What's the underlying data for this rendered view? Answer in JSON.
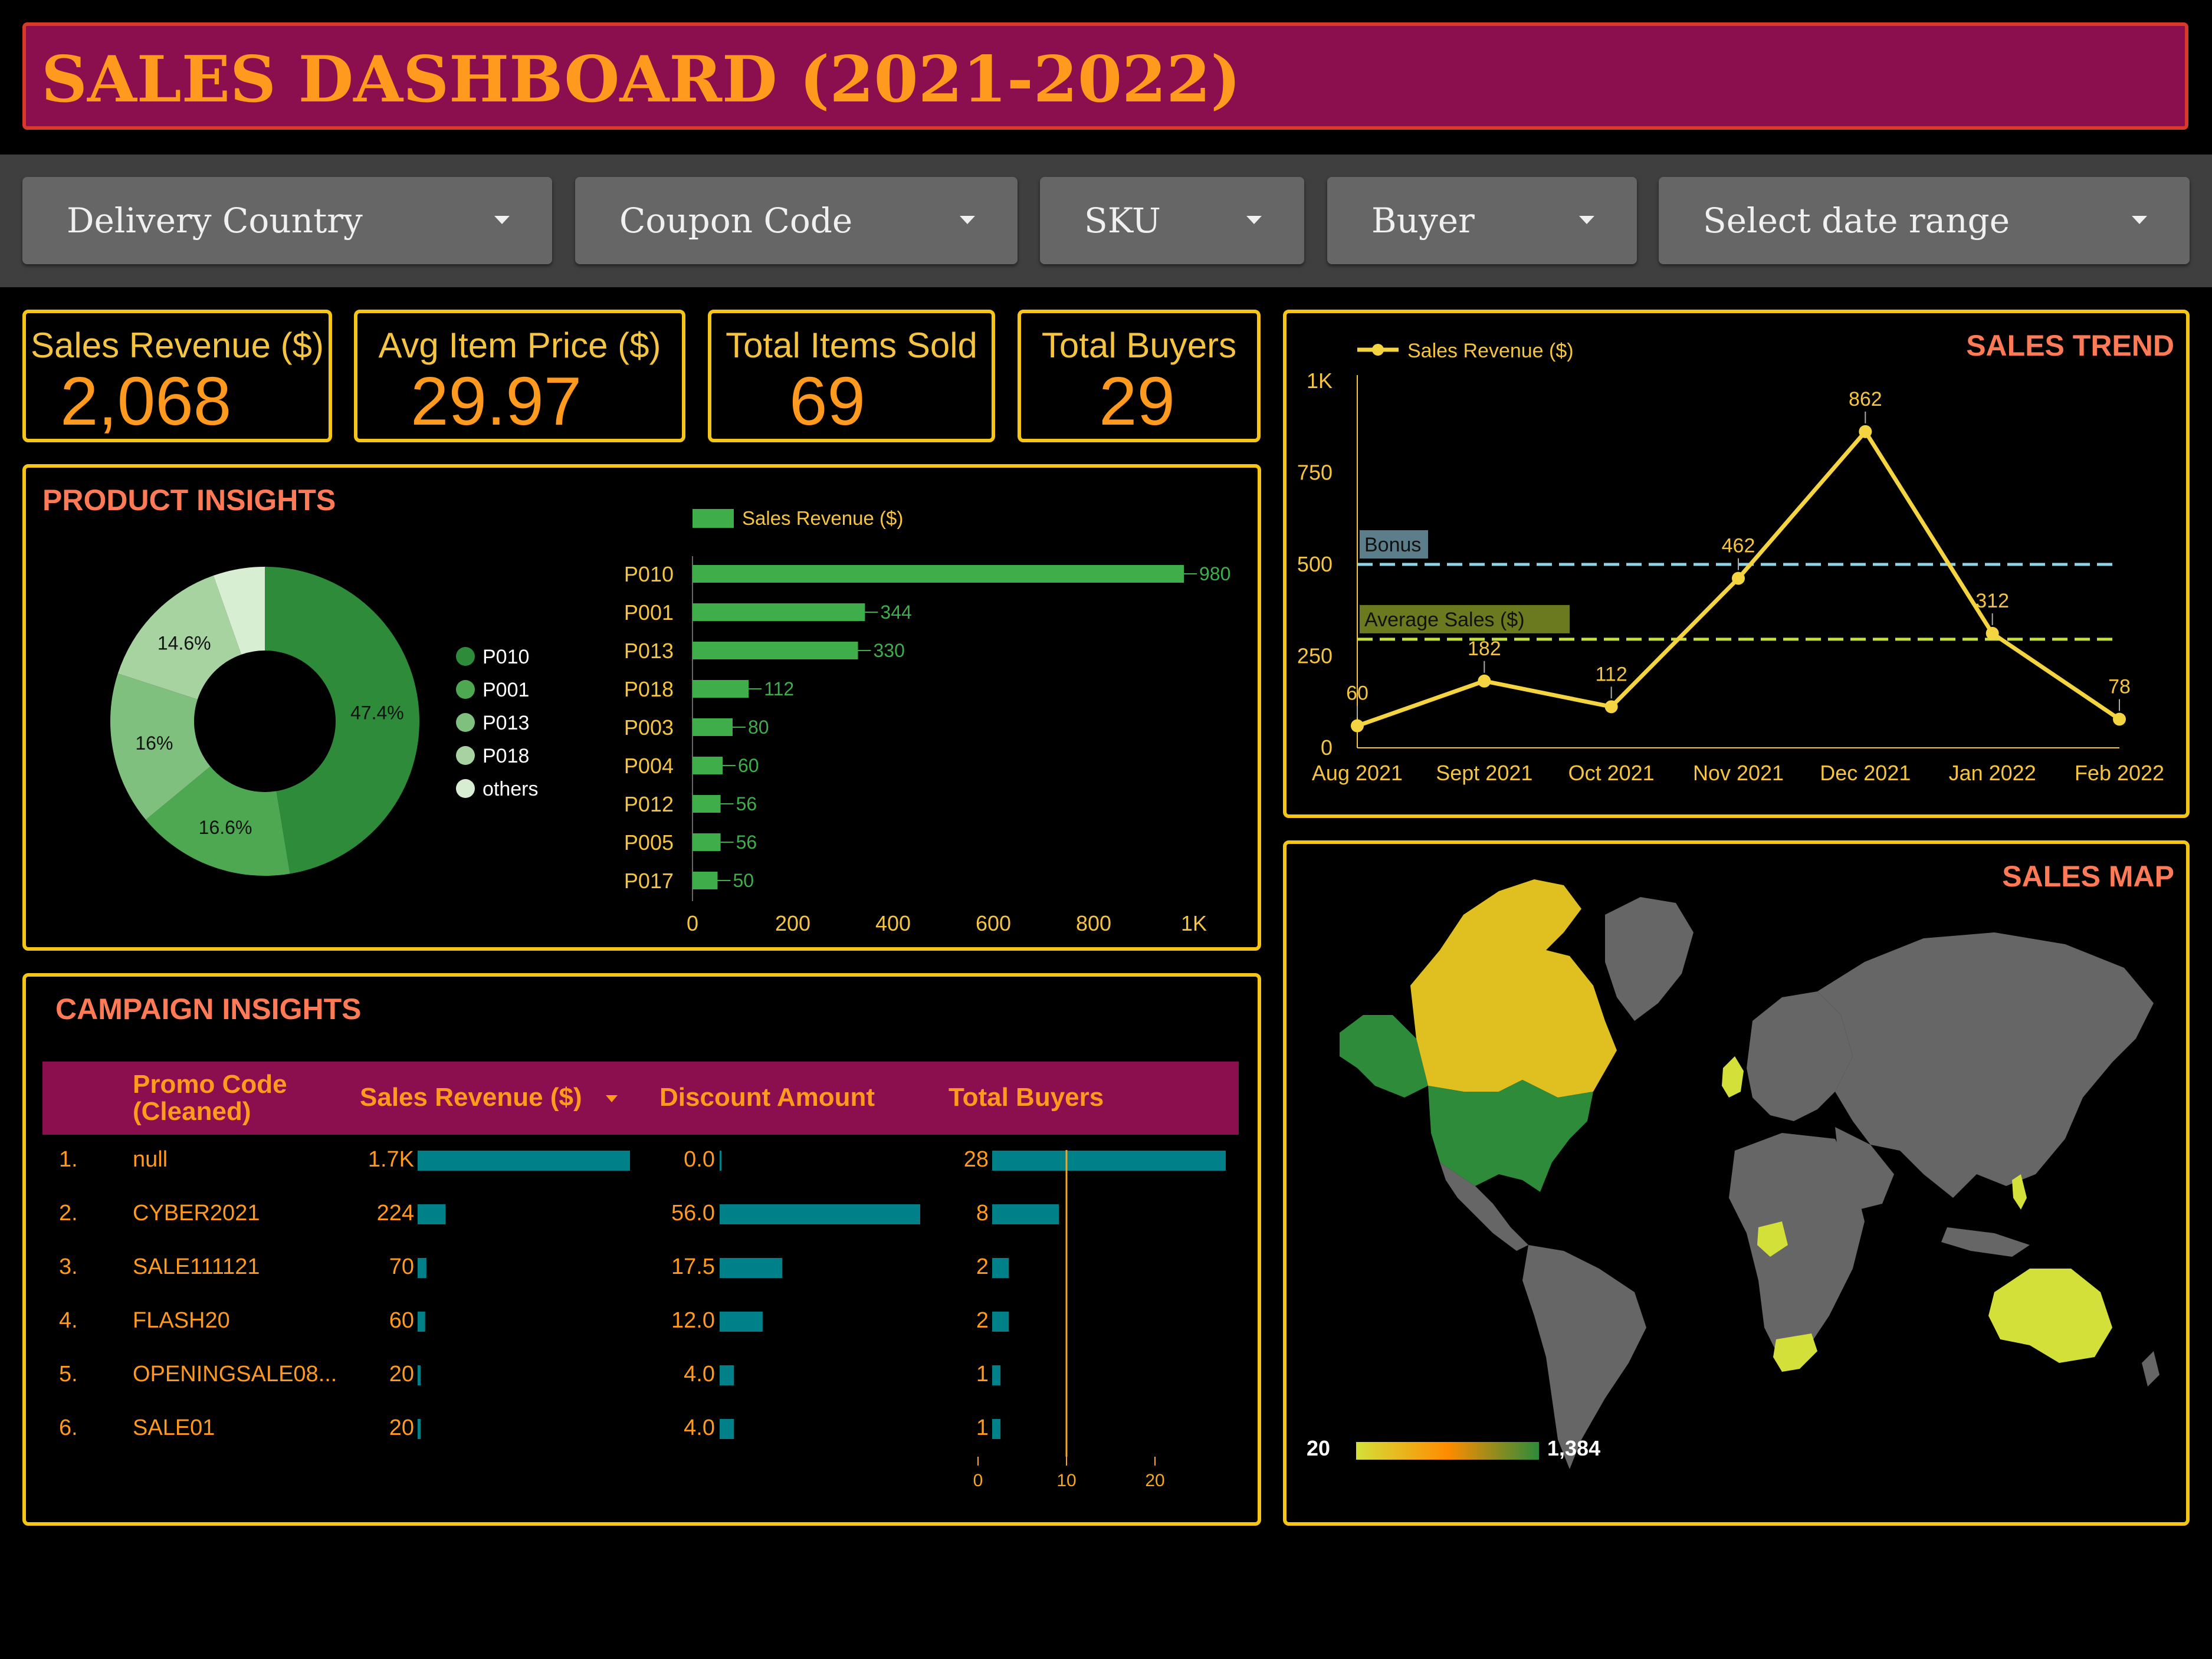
{
  "header": {
    "title": "SALES DASHBOARD (2021-2022)"
  },
  "filters": [
    {
      "label": "Delivery Country"
    },
    {
      "label": "Coupon Code"
    },
    {
      "label": "SKU"
    },
    {
      "label": "Buyer"
    },
    {
      "label": "Select date range"
    }
  ],
  "kpis": [
    {
      "label": "Sales Revenue ($)",
      "value": "2,068"
    },
    {
      "label": "Avg Item Price ($)",
      "value": "29.97"
    },
    {
      "label": "Total Items Sold",
      "value": "69"
    },
    {
      "label": "Total Buyers",
      "value": "29"
    }
  ],
  "product_insights": {
    "title": "PRODUCT INSIGHTS"
  },
  "campaign_insights": {
    "title": "CAMPAIGN INSIGHTS",
    "columns": [
      "Promo Code (Cleaned)",
      "Sales Revenue ($)",
      "Discount Amount",
      "Total Buyers"
    ],
    "col1_line1": "Promo Code",
    "col1_line2": "(Cleaned)",
    "rows": [
      {
        "rank": "1.",
        "code": "null",
        "revenue_label": "1.7K",
        "revenue": 1700,
        "discount_label": "0.0",
        "discount": 0,
        "buyers_label": "28",
        "buyers": 28
      },
      {
        "rank": "2.",
        "code": "CYBER2021",
        "revenue_label": "224",
        "revenue": 224,
        "discount_label": "56.0",
        "discount": 56,
        "buyers_label": "8",
        "buyers": 8
      },
      {
        "rank": "3.",
        "code": "SALE111121",
        "revenue_label": "70",
        "revenue": 70,
        "discount_label": "17.5",
        "discount": 17.5,
        "buyers_label": "2",
        "buyers": 2
      },
      {
        "rank": "4.",
        "code": "FLASH20",
        "revenue_label": "60",
        "revenue": 60,
        "discount_label": "12.0",
        "discount": 12,
        "buyers_label": "2",
        "buyers": 2
      },
      {
        "rank": "5.",
        "code": "OPENINGSALE08...",
        "revenue_label": "20",
        "revenue": 20,
        "discount_label": "4.0",
        "discount": 4,
        "buyers_label": "1",
        "buyers": 1
      },
      {
        "rank": "6.",
        "code": "SALE01",
        "revenue_label": "20",
        "revenue": 20,
        "discount_label": "4.0",
        "discount": 4,
        "buyers_label": "1",
        "buyers": 1
      }
    ],
    "buyers_axis_ticks": [
      "0",
      "10",
      "20"
    ],
    "buyers_reference": 10,
    "bar_color": "#00818a"
  },
  "sales_trend": {
    "title": "SALES TREND"
  },
  "sales_map": {
    "title": "SALES MAP",
    "legend_min": "20",
    "legend_max": "1,384",
    "colors": {
      "land": "#666666",
      "low": "#d4e03a",
      "mid": "#e0c020",
      "high": "#2e8b3a"
    }
  },
  "chart_data": [
    {
      "type": "pie",
      "subtype": "donut",
      "categories": [
        "P010",
        "P001",
        "P013",
        "P018",
        "others"
      ],
      "values": [
        47.4,
        16.6,
        16.0,
        14.6,
        5.4
      ],
      "labels": [
        "47.4%",
        "16.6%",
        "16%",
        "14.6%",
        ""
      ],
      "colors": [
        "#2e8b3a",
        "#4ea852",
        "#7fc07f",
        "#a6d3a0",
        "#d8eed2"
      ],
      "legend": "right"
    },
    {
      "type": "bar",
      "orientation": "horizontal",
      "categories": [
        "P010",
        "P001",
        "P013",
        "P018",
        "P003",
        "P004",
        "P012",
        "P005",
        "P017"
      ],
      "series": [
        {
          "name": "Sales Revenue ($)",
          "values": [
            980,
            344,
            330,
            112,
            80,
            60,
            56,
            56,
            50
          ]
        }
      ],
      "xlim": [
        0,
        1000
      ],
      "xticks": [
        "0",
        "200",
        "400",
        "600",
        "800",
        "1K"
      ],
      "color": "#3fae4a",
      "legend": "top"
    },
    {
      "type": "line",
      "categories": [
        "Aug 2021",
        "Sept 2021",
        "Oct 2021",
        "Nov 2021",
        "Dec 2021",
        "Jan 2022",
        "Feb 2022"
      ],
      "series": [
        {
          "name": "Sales Revenue ($)",
          "values": [
            60,
            182,
            112,
            462,
            862,
            312,
            78
          ]
        }
      ],
      "ylim": [
        0,
        1000
      ],
      "yticks": [
        "0",
        "250",
        "500",
        "750",
        "1K"
      ],
      "reference_lines": [
        {
          "label": "Bonus",
          "value": 500,
          "color": "#8fd3e8"
        },
        {
          "label": "Average Sales ($)",
          "value": 296,
          "color": "#c8e03c"
        }
      ],
      "color": "#f5d442",
      "legend": "top-left"
    }
  ]
}
